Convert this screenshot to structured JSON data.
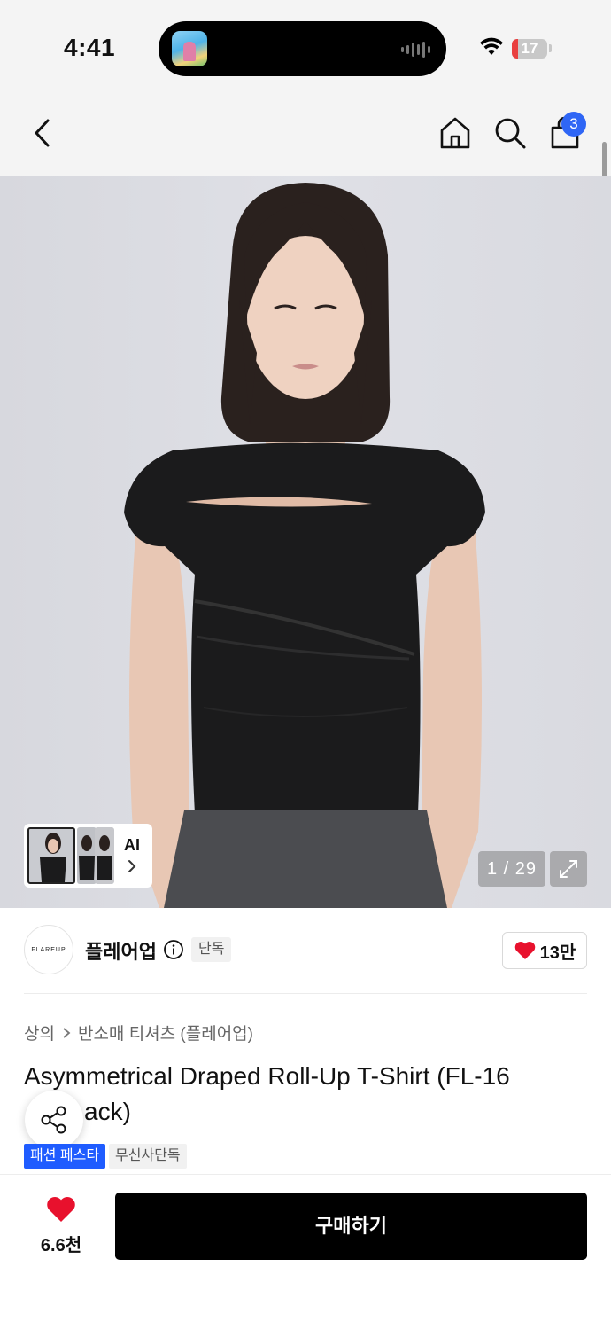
{
  "status_bar": {
    "time": "4:41",
    "battery_level": "17",
    "battery_fraction": 0.17,
    "battery_color": "#e94040"
  },
  "nav": {
    "back_icon": "chevron-left-icon",
    "home_icon": "home-icon",
    "search_icon": "search-icon",
    "cart_icon": "shopping-bag-icon",
    "cart_count": "3",
    "badge_color": "#2f66f5"
  },
  "gallery": {
    "ai_label": "AI",
    "counter": "1 / 29",
    "expand_icon": "expand-icon"
  },
  "brand": {
    "logo_text": "FLAREUP",
    "name": "플레어업",
    "exclusive_tag": "단독",
    "like_count": "13만",
    "heart_color": "#e8112d"
  },
  "product": {
    "breadcrumb": [
      "상의",
      "반소매 티셔츠 (플레어업)"
    ],
    "title_line1": "Asymmetrical Draped Roll-Up T-Shirt (FL-16",
    "title_line2": "ack)",
    "tags": [
      "패션 페스타",
      "무신사단독"
    ],
    "tag_colors": {
      "festa": "#1f5cff"
    }
  },
  "bottom_bar": {
    "wish_count": "6.6천",
    "buy_label": "구매하기"
  }
}
